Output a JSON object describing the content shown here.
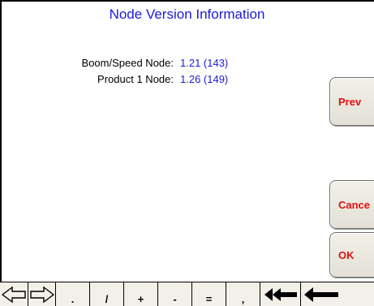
{
  "screen": {
    "title": "Node Version Information"
  },
  "nodes": [
    {
      "label": "Boom/Speed Node:",
      "version": "1.21 (143)"
    },
    {
      "label": "Product 1 Node:",
      "version": "1.26 (149)"
    }
  ],
  "buttons": {
    "prev_label": "Prev",
    "cancel_label": "Cance",
    "ok_label": "OK"
  },
  "keyboard": {
    "keys": [
      {
        "name": "arrow-left-key",
        "label": "",
        "icon": "left-arrow-outline-icon"
      },
      {
        "name": "arrow-right-key",
        "label": "",
        "icon": "right-arrow-outline-icon"
      },
      {
        "name": "key-period",
        "label": "."
      },
      {
        "name": "key-slash",
        "label": "/"
      },
      {
        "name": "key-plus",
        "label": "+"
      },
      {
        "name": "key-minus",
        "label": "-"
      },
      {
        "name": "key-equals",
        "label": "="
      },
      {
        "name": "key-comma",
        "label": ","
      },
      {
        "name": "clear-all-key",
        "label": "",
        "icon": "double-left-arrow-icon"
      },
      {
        "name": "backspace-key",
        "label": "",
        "icon": "backspace-arrow-icon"
      }
    ]
  },
  "colors": {
    "title": "#1b1bd6",
    "value": "#1b1bd6",
    "button_text": "#e01010",
    "button_face": "#f2f0e8"
  }
}
